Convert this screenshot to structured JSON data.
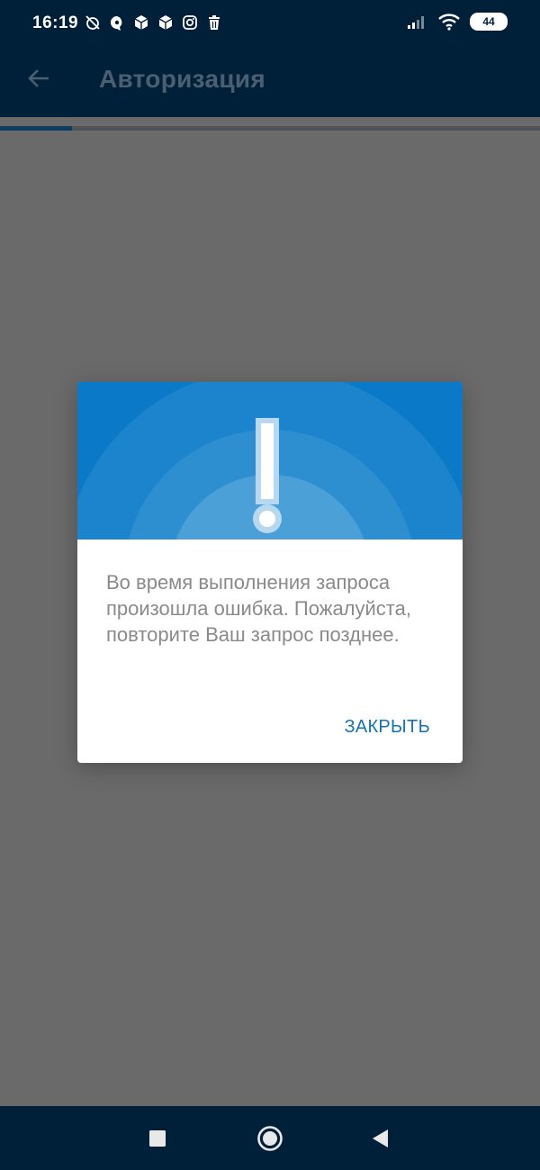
{
  "status_bar": {
    "time": "16:19",
    "battery": "44",
    "left_icons": [
      "alarm-off-icon",
      "messenger-icon",
      "box-icon",
      "box-icon",
      "instagram-icon",
      "trash-icon"
    ],
    "right_icons": [
      "signal-icon",
      "wifi-icon",
      "battery-icon"
    ]
  },
  "app_bar": {
    "title": "Авторизация",
    "back_icon": "arrow-left-icon"
  },
  "progress": {
    "fraction": 0.133,
    "color": "#0d3d63"
  },
  "dialog": {
    "icon": "exclamation-icon",
    "header_color": "#0a7ac8",
    "message": "Во время выполнения запроса произошла ошибка. Пожалуйста, повторите Ваш запрос позднее.",
    "close_label": "ЗАКРЫТЬ"
  },
  "nav_bar": {
    "icons": [
      "square-icon",
      "circle-home-icon",
      "triangle-back-icon"
    ]
  },
  "colors": {
    "bar_bg": "#00203a",
    "scrim": "#6a6a6a",
    "accent": "#1372b8"
  }
}
